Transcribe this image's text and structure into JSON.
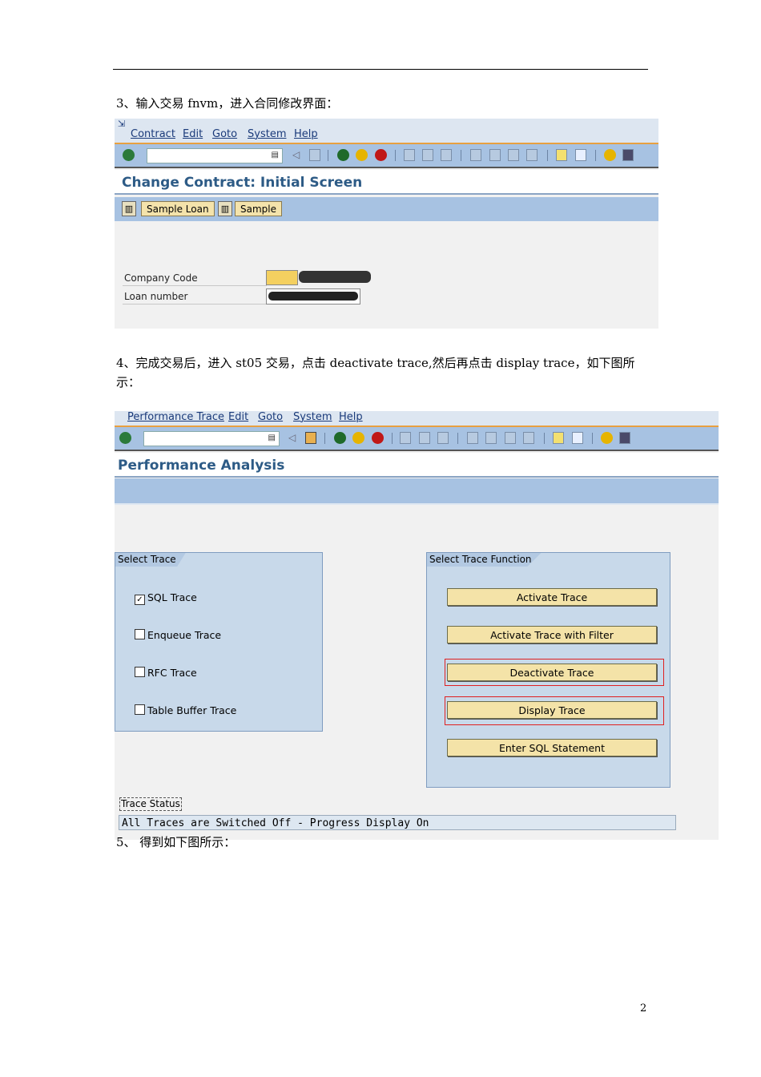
{
  "doc": {
    "step3": "3、输入交易 fnvm，进入合同修改界面：",
    "step4_line1": "4、完成交易后，进入 st05 交易，点击 deactivate trace,然后再点击 display trace，如下图所",
    "step4_line2": "示：",
    "step5": "5、 得到如下图所示：",
    "page_number": "2"
  },
  "screen1": {
    "menu": [
      "Contract",
      "Edit",
      "Goto",
      "System",
      "Help"
    ],
    "title": "Change Contract: Initial Screen",
    "app_buttons": [
      "Sample Loan",
      "Sample"
    ],
    "fields": [
      {
        "label": "Company Code"
      },
      {
        "label": "Loan number"
      }
    ]
  },
  "screen2": {
    "menu": [
      "Performance Trace",
      "Edit",
      "Goto",
      "System",
      "Help"
    ],
    "title": "Performance Analysis",
    "select_trace": {
      "title": "Select Trace",
      "items": [
        {
          "label": "SQL Trace",
          "checked": true
        },
        {
          "label": "Enqueue Trace",
          "checked": false
        },
        {
          "label": "RFC Trace",
          "checked": false
        },
        {
          "label": "Table Buffer Trace",
          "checked": false
        }
      ]
    },
    "functions": {
      "title": "Select Trace Function",
      "buttons": [
        "Activate Trace",
        "Activate Trace with Filter",
        "Deactivate Trace",
        "Display Trace",
        "Enter SQL Statement"
      ]
    },
    "status_label": "Trace Status",
    "status_text": "All Traces are Switched Off - Progress Display On"
  }
}
